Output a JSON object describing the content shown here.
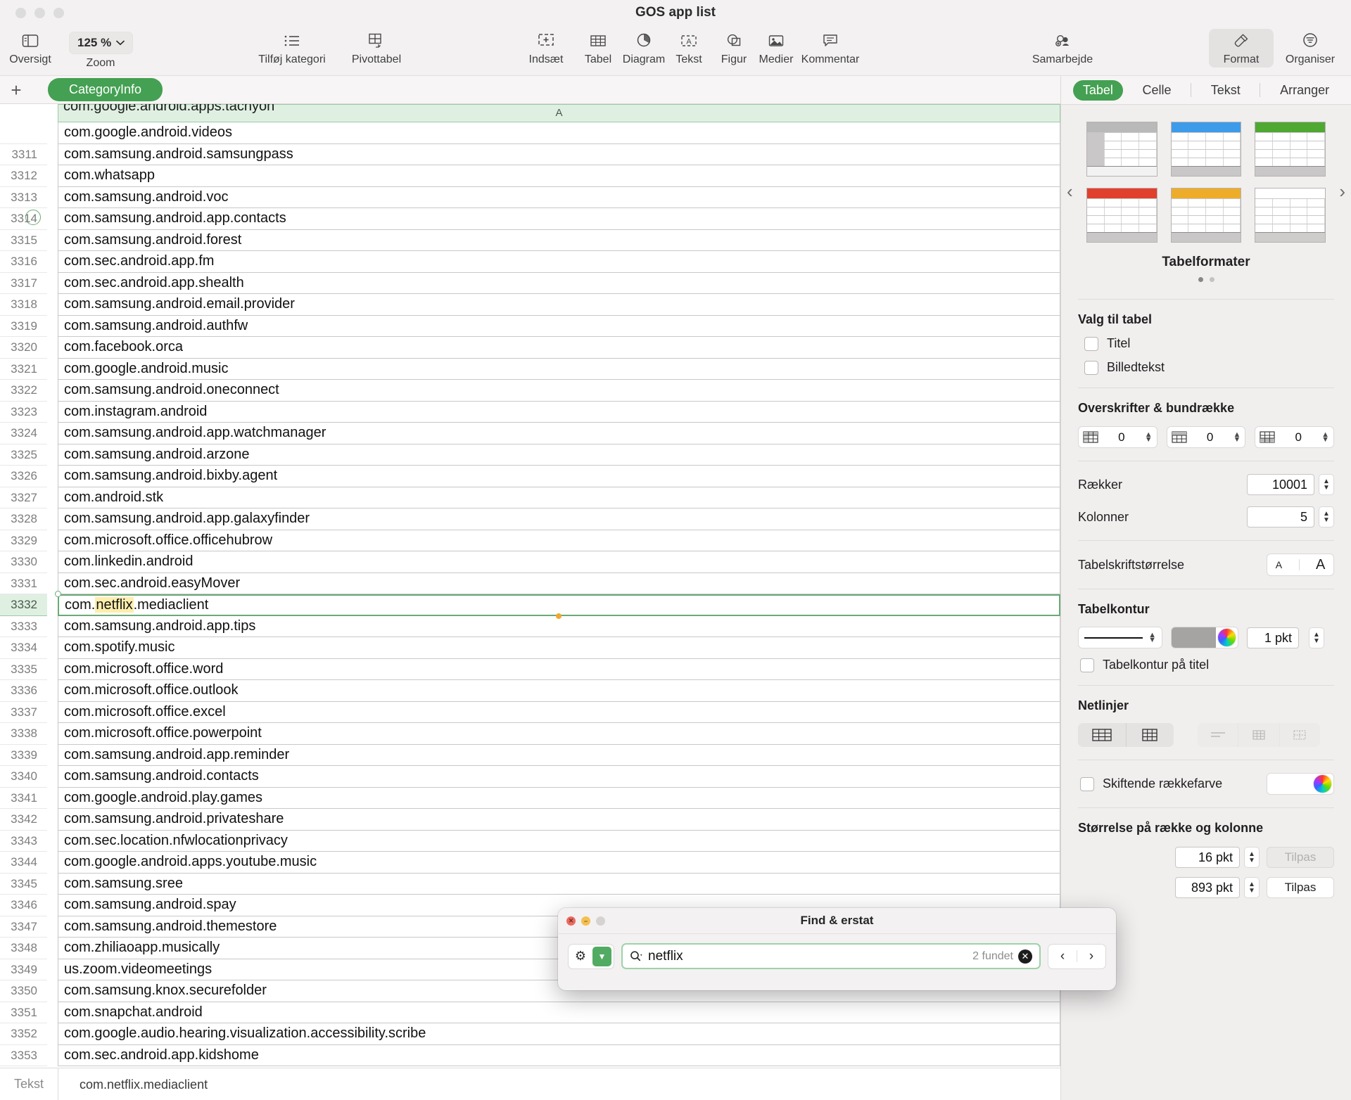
{
  "window": {
    "title": "GOS app list"
  },
  "toolbar": {
    "zoom_value": "125 %",
    "items": [
      {
        "label": "Oversigt",
        "icon": "sidebar-icon"
      },
      {
        "label": "Zoom",
        "icon": "zoom-icon"
      },
      {
        "label": "Tilføj kategori",
        "icon": "list-icon"
      },
      {
        "label": "Pivottabel",
        "icon": "pivot-table-icon"
      },
      {
        "label": "Indsæt",
        "icon": "insert-icon"
      },
      {
        "label": "Tabel",
        "icon": "table-icon"
      },
      {
        "label": "Diagram",
        "icon": "chart-icon"
      },
      {
        "label": "Tekst",
        "icon": "text-box-icon"
      },
      {
        "label": "Figur",
        "icon": "shape-icon"
      },
      {
        "label": "Medier",
        "icon": "media-icon"
      },
      {
        "label": "Kommentar",
        "icon": "comment-icon"
      },
      {
        "label": "Samarbejde",
        "icon": "collaborate-icon"
      },
      {
        "label": "Format",
        "icon": "format-brush-icon"
      },
      {
        "label": "Organiser",
        "icon": "organize-icon"
      }
    ]
  },
  "sheet_bar": {
    "add_label": "+",
    "tabs": [
      {
        "label": "CategoryInfo",
        "active": true
      }
    ]
  },
  "grid": {
    "column_header": "A",
    "clipped_top_text": "com.google.android.apps.tachyon",
    "partial_row_text": "com.google.android.videos",
    "rows": [
      {
        "num": "3311",
        "value": "com.samsung.android.samsungpass"
      },
      {
        "num": "3312",
        "value": "com.whatsapp"
      },
      {
        "num": "3313",
        "value": "com.samsung.android.voc"
      },
      {
        "num": "3314",
        "value": "com.samsung.android.app.contacts"
      },
      {
        "num": "3315",
        "value": "com.samsung.android.forest"
      },
      {
        "num": "3316",
        "value": "com.sec.android.app.fm"
      },
      {
        "num": "3317",
        "value": "com.sec.android.app.shealth"
      },
      {
        "num": "3318",
        "value": "com.samsung.android.email.provider"
      },
      {
        "num": "3319",
        "value": "com.samsung.android.authfw"
      },
      {
        "num": "3320",
        "value": "com.facebook.orca"
      },
      {
        "num": "3321",
        "value": "com.google.android.music"
      },
      {
        "num": "3322",
        "value": "com.samsung.android.oneconnect"
      },
      {
        "num": "3323",
        "value": "com.instagram.android"
      },
      {
        "num": "3324",
        "value": "com.samsung.android.app.watchmanager"
      },
      {
        "num": "3325",
        "value": "com.samsung.android.arzone"
      },
      {
        "num": "3326",
        "value": "com.samsung.android.bixby.agent"
      },
      {
        "num": "3327",
        "value": "com.android.stk"
      },
      {
        "num": "3328",
        "value": "com.samsung.android.app.galaxyfinder"
      },
      {
        "num": "3329",
        "value": "com.microsoft.office.officehubrow"
      },
      {
        "num": "3330",
        "value": "com.linkedin.android"
      },
      {
        "num": "3331",
        "value": "com.sec.android.easyMover"
      },
      {
        "num": "3332",
        "value": "com.netflix.mediaclient",
        "selected": true,
        "highlight": "netflix"
      },
      {
        "num": "3333",
        "value": "com.samsung.android.app.tips"
      },
      {
        "num": "3334",
        "value": "com.spotify.music"
      },
      {
        "num": "3335",
        "value": "com.microsoft.office.word"
      },
      {
        "num": "3336",
        "value": "com.microsoft.office.outlook"
      },
      {
        "num": "3337",
        "value": "com.microsoft.office.excel"
      },
      {
        "num": "3338",
        "value": "com.microsoft.office.powerpoint"
      },
      {
        "num": "3339",
        "value": "com.samsung.android.app.reminder"
      },
      {
        "num": "3340",
        "value": "com.samsung.android.contacts"
      },
      {
        "num": "3341",
        "value": "com.google.android.play.games"
      },
      {
        "num": "3342",
        "value": "com.samsung.android.privateshare"
      },
      {
        "num": "3343",
        "value": "com.sec.location.nfwlocationprivacy"
      },
      {
        "num": "3344",
        "value": "com.google.android.apps.youtube.music"
      },
      {
        "num": "3345",
        "value": "com.samsung.sree"
      },
      {
        "num": "3346",
        "value": "com.samsung.android.spay"
      },
      {
        "num": "3347",
        "value": "com.samsung.android.themestore"
      },
      {
        "num": "3348",
        "value": "com.zhiliaoapp.musically"
      },
      {
        "num": "3349",
        "value": "us.zoom.videomeetings"
      },
      {
        "num": "3350",
        "value": "com.samsung.knox.securefolder"
      },
      {
        "num": "3351",
        "value": "com.snapchat.android"
      },
      {
        "num": "3352",
        "value": "com.google.audio.hearing.visualization.accessibility.scribe"
      },
      {
        "num": "3353",
        "value": "com.sec.android.app.kidshome"
      }
    ]
  },
  "status_bar": {
    "type_label": "Tekst",
    "value": "com.netflix.mediaclient"
  },
  "inspector": {
    "tabs": [
      {
        "label": "Tabel",
        "active": true
      },
      {
        "label": "Celle",
        "active": false
      },
      {
        "label": "Tekst",
        "active": false
      },
      {
        "label": "Arranger",
        "active": false
      }
    ],
    "styles": {
      "title": "Tabelformater",
      "swatches": [
        "#b9b9b9",
        "#3d9bea",
        "#4fa831",
        "#e0402c",
        "#edac29",
        "#ffffff"
      ],
      "page_dots": 2,
      "active_dot": 0
    },
    "table_options": {
      "title": "Valg til tabel",
      "checkboxes": [
        {
          "label": "Titel",
          "checked": false
        },
        {
          "label": "Billedtekst",
          "checked": false
        }
      ]
    },
    "headers_footers": {
      "title": "Overskrifter & bundrække",
      "steppers": [
        {
          "icon": "header-rows-icon",
          "value": "0"
        },
        {
          "icon": "header-columns-icon",
          "value": "0"
        },
        {
          "icon": "footer-rows-icon",
          "value": "0"
        }
      ]
    },
    "size": {
      "rows_label": "Rækker",
      "rows_value": "10001",
      "cols_label": "Kolonner",
      "cols_value": "5"
    },
    "font_size": {
      "label": "Tabelskriftstørrelse",
      "small": "A",
      "large": "A"
    },
    "outline": {
      "title": "Tabelkontur",
      "width_value": "1 pkt",
      "color": "#a6a3a3",
      "checkbox": {
        "label": "Tabelkontur på titel",
        "checked": false
      }
    },
    "gridlines": {
      "title": "Netlinjer",
      "buttons": [
        "grid-horizontal-icon",
        "grid-vertical-icon",
        "grid-dash-1-icon",
        "grid-dash-2-icon",
        "grid-dash-3-icon"
      ]
    },
    "alt_row": {
      "label": "Skiftende rækkefarve",
      "checked": false,
      "color": "#ffffff"
    },
    "row_col_size": {
      "title": "Størrelse på række og kolonne",
      "row_value": "16 pkt",
      "row_fit_label": "Tilpas",
      "row_fit_disabled": true,
      "col_value": "893 pkt",
      "col_fit_label": "Tilpas",
      "col_fit_disabled": false
    }
  },
  "find_dialog": {
    "title": "Find & erstat",
    "query": "netflix",
    "result_count": "2 fundet",
    "gear_icon": "gear-icon",
    "chevron_icon": "chevron-down-icon",
    "prev_icon": "‹",
    "next_icon": "›"
  }
}
